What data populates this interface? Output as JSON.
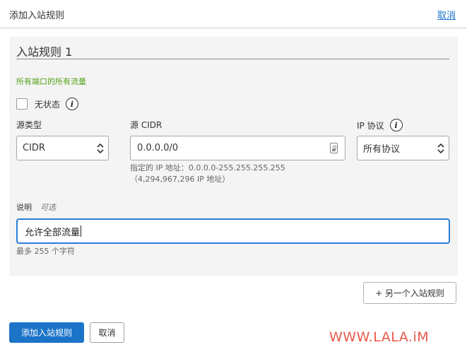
{
  "header": {
    "title": "添加入站规则",
    "cancel_link": "取消"
  },
  "rule": {
    "title": "入站规则 1",
    "traffic_summary": "所有端口的所有流量",
    "stateless": {
      "label": "无状态",
      "checked": false,
      "info_icon": "info-icon"
    },
    "source_type": {
      "label": "源类型",
      "value": "CIDR"
    },
    "source_cidr": {
      "label": "源 CIDR",
      "value": "0.0.0.0/0",
      "hint_line1": "指定的 IP 地址：0.0.0.0-255.255.255.255",
      "hint_line2": "（4,294,967,296 IP 地址）"
    },
    "ip_protocol": {
      "label": "IP 协议",
      "value": "所有协议",
      "info_icon": "info-icon"
    },
    "description": {
      "label": "说明",
      "optional": "可选",
      "value": "允许全部流量",
      "hint": "最多 255 个字符"
    }
  },
  "buttons": {
    "add_another": "+ 另一个入站规则",
    "submit": "添加入站规则",
    "cancel": "取消"
  },
  "watermark": "WWW.LALA.iM",
  "colors": {
    "primary": "#1c74c9",
    "link": "#1a73c9",
    "traffic_summary": "#54a31a",
    "focus_border": "#2a7dd8",
    "watermark": "#e85a4a"
  }
}
